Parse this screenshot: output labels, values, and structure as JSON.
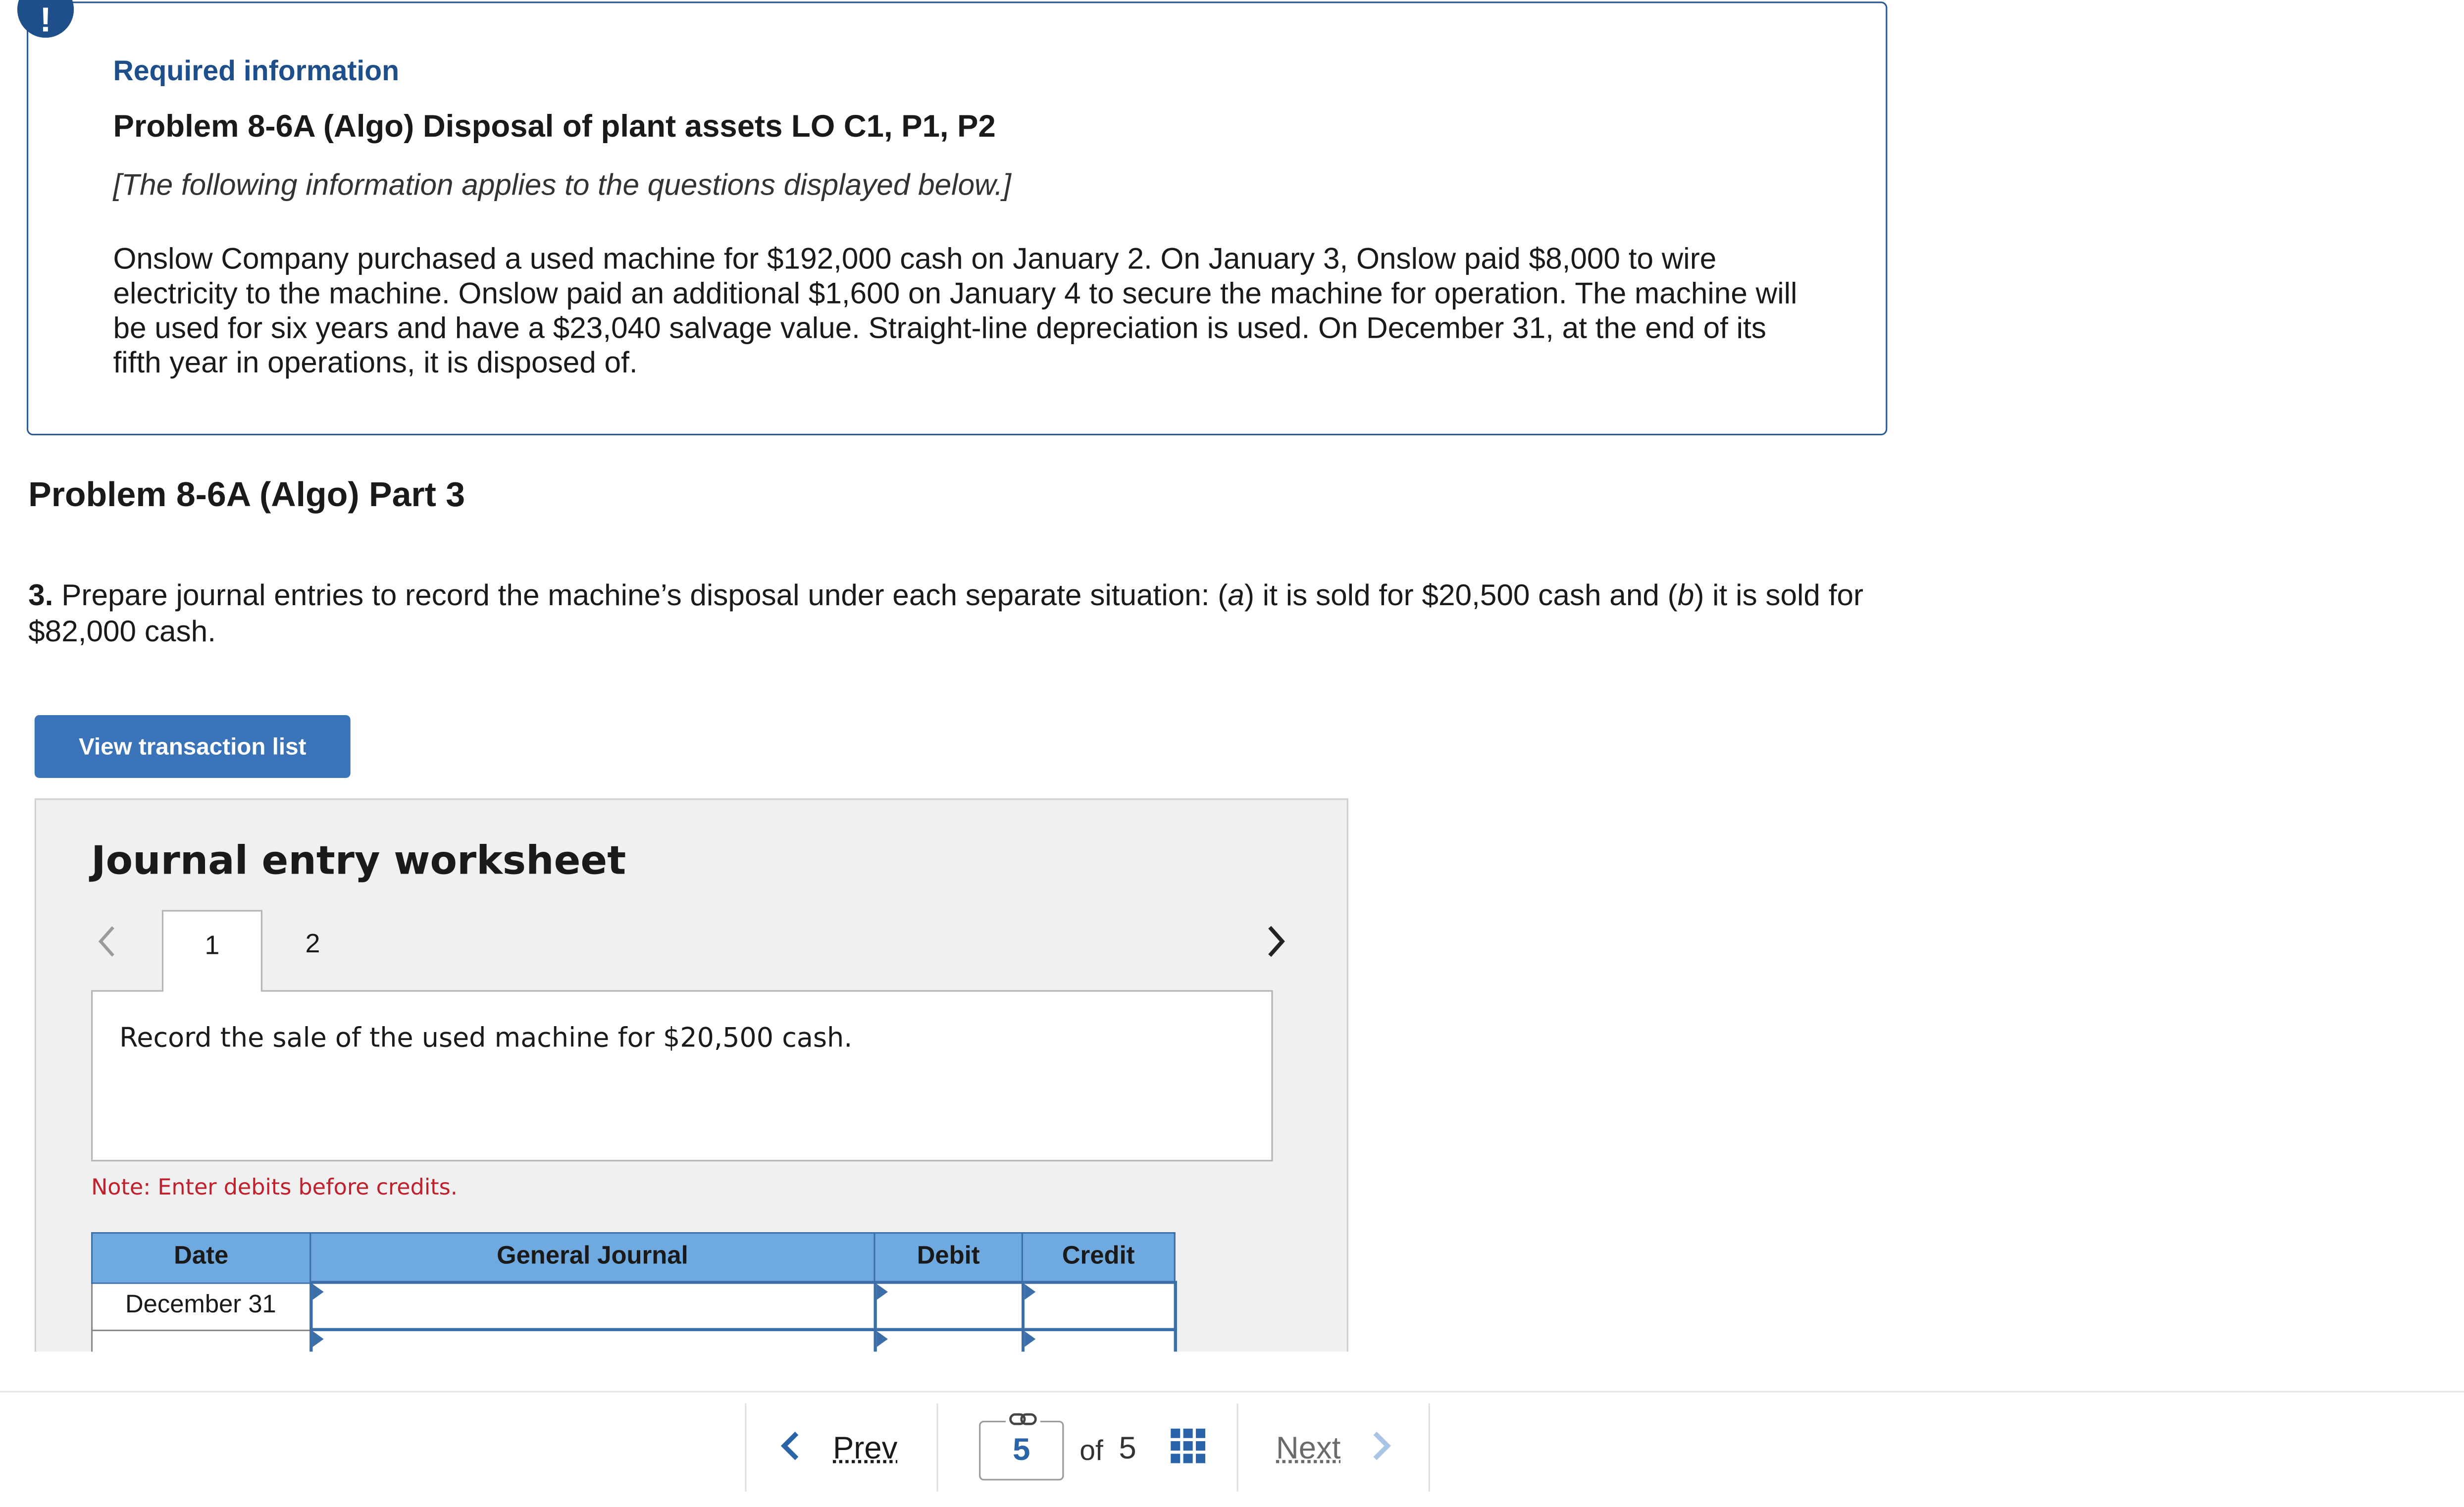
{
  "info": {
    "alert_glyph": "!",
    "required": "Required information",
    "problem_title": "Problem 8-6A (Algo) Disposal of plant assets LO C1, P1, P2",
    "note": "[The following information applies to the questions displayed below.]",
    "paragraph": "Onslow Company purchased a used machine for $192,000 cash on January 2. On January 3, Onslow paid $8,000 to wire electricity to the machine. Onslow paid an additional $1,600 on January 4 to secure the machine for operation. The machine will be used for six years and have a $23,040 salvage value. Straight-line depreciation is used. On December 31, at the end of its fifth year in operations, it is disposed of."
  },
  "part_title": "Problem 8-6A (Algo) Part 3",
  "question": {
    "number": "3.",
    "text_1": " Prepare journal entries to record the machine’s disposal under each separate situation: (",
    "a": "a",
    "text_2": ") it is sold for $20,500 cash and (",
    "b": "b",
    "text_3": ") it is sold for $82,000 cash."
  },
  "view_transaction_button": "View transaction list",
  "worksheet": {
    "title": "Journal entry worksheet",
    "tabs": [
      "1",
      "2"
    ],
    "prompt": "Record the sale of the used machine for $20,500 cash.",
    "note": "Note: Enter debits before credits.",
    "columns": [
      "Date",
      "General Journal",
      "Debit",
      "Credit"
    ],
    "rows": [
      {
        "date": "December 31",
        "account": "",
        "debit": "",
        "credit": ""
      },
      {
        "date": "",
        "account": "",
        "debit": "",
        "credit": ""
      }
    ]
  },
  "pagination": {
    "prev": "Prev",
    "current": "5",
    "of": "of",
    "total": "5",
    "next": "Next"
  }
}
